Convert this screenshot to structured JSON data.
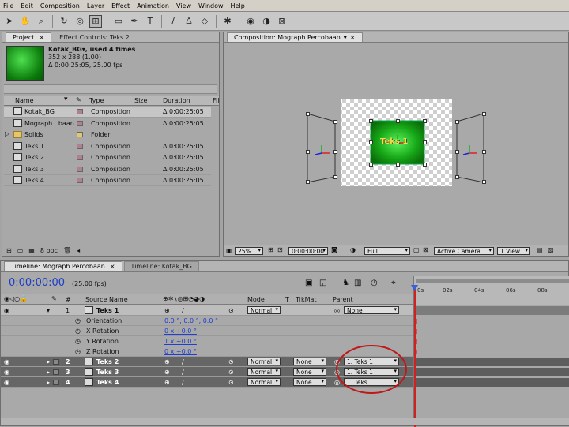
{
  "menu": [
    "File",
    "Edit",
    "Composition",
    "Layer",
    "Effect",
    "Animation",
    "View",
    "Window",
    "Help"
  ],
  "project_panel": {
    "tab_project": "Project",
    "tab_effect_controls": "Effect Controls: Teks 2",
    "item_name": "Kotak_BG▾, used 4 times",
    "item_size": "352 x 288 (1.00)",
    "item_duration": "Δ 0:00:25:05, 25.00 fps",
    "columns": {
      "name": "Name",
      "type": "Type",
      "size": "Size",
      "duration": "Duration",
      "fi": "Fil"
    },
    "rows": [
      {
        "name": "Kotak_BG",
        "type": "Composition",
        "duration": "Δ 0:00:25:05",
        "folder": false
      },
      {
        "name": "Mograph...baan",
        "type": "Composition",
        "duration": "Δ 0:00:25:05",
        "folder": false
      },
      {
        "name": "Solids",
        "type": "Folder",
        "duration": "",
        "folder": true
      },
      {
        "name": "Teks 1",
        "type": "Composition",
        "duration": "Δ 0:00:25:05",
        "folder": false
      },
      {
        "name": "Teks 2",
        "type": "Composition",
        "duration": "Δ 0:00:25:05",
        "folder": false
      },
      {
        "name": "Teks 3",
        "type": "Composition",
        "duration": "Δ 0:00:25:05",
        "folder": false
      },
      {
        "name": "Teks 4",
        "type": "Composition",
        "duration": "Δ 0:00:25:05",
        "folder": false
      }
    ],
    "bpc": "8 bpc"
  },
  "comp_panel": {
    "tab": "Composition: Mograph Percobaan",
    "center_label": "Teks 1",
    "zoom": "25%",
    "timecode": "0:00:00:00",
    "resolution": "Full",
    "camera": "Active Camera",
    "view": "1 View"
  },
  "timeline": {
    "tab_active": "Timeline: Mograph Percobaan",
    "tab_other": "Timeline: Kotak_BG",
    "timecode": "0:00:00:00",
    "fps": "(25.00 fps)",
    "col_num": "#",
    "col_source": "Source Name",
    "col_mode": "Mode",
    "col_t": "T",
    "col_trkmat": "TrkMat",
    "col_parent": "Parent",
    "ruler": [
      "0s",
      "02s",
      "04s",
      "06s",
      "08s"
    ],
    "layer1": {
      "num": "1",
      "name": "Teks 1",
      "mode": "Normal",
      "parent": "None"
    },
    "props": [
      {
        "name": "Orientation",
        "value": "0.0 °, 0.0 °, 0.0 °"
      },
      {
        "name": "X Rotation",
        "value": "0 x +0.0 °"
      },
      {
        "name": "Y Rotation",
        "value": "1 x +0.0 °"
      },
      {
        "name": "Z Rotation",
        "value": "0 x +0.0 °"
      }
    ],
    "layers": [
      {
        "num": "2",
        "name": "Teks 2",
        "mode": "Normal",
        "trkmat": "None",
        "parent": "1. Teks 1"
      },
      {
        "num": "3",
        "name": "Teks 3",
        "mode": "Normal",
        "trkmat": "None",
        "parent": "1. Teks 1"
      },
      {
        "num": "4",
        "name": "Teks 4",
        "mode": "Normal",
        "trkmat": "None",
        "parent": "1. Teks 1"
      }
    ]
  }
}
